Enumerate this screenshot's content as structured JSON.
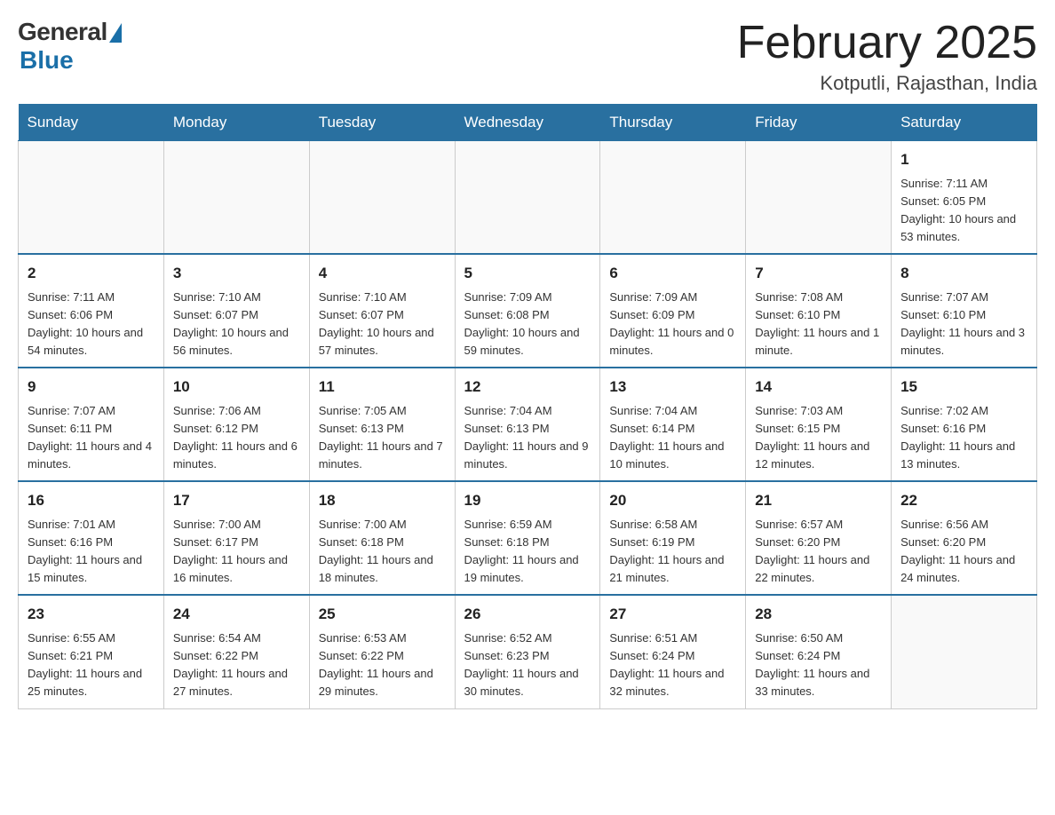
{
  "logo": {
    "general": "General",
    "blue": "Blue"
  },
  "header": {
    "title": "February 2025",
    "location": "Kotputli, Rajasthan, India"
  },
  "days_of_week": [
    "Sunday",
    "Monday",
    "Tuesday",
    "Wednesday",
    "Thursday",
    "Friday",
    "Saturday"
  ],
  "weeks": [
    [
      {
        "day": "",
        "info": ""
      },
      {
        "day": "",
        "info": ""
      },
      {
        "day": "",
        "info": ""
      },
      {
        "day": "",
        "info": ""
      },
      {
        "day": "",
        "info": ""
      },
      {
        "day": "",
        "info": ""
      },
      {
        "day": "1",
        "info": "Sunrise: 7:11 AM\nSunset: 6:05 PM\nDaylight: 10 hours and 53 minutes."
      }
    ],
    [
      {
        "day": "2",
        "info": "Sunrise: 7:11 AM\nSunset: 6:06 PM\nDaylight: 10 hours and 54 minutes."
      },
      {
        "day": "3",
        "info": "Sunrise: 7:10 AM\nSunset: 6:07 PM\nDaylight: 10 hours and 56 minutes."
      },
      {
        "day": "4",
        "info": "Sunrise: 7:10 AM\nSunset: 6:07 PM\nDaylight: 10 hours and 57 minutes."
      },
      {
        "day": "5",
        "info": "Sunrise: 7:09 AM\nSunset: 6:08 PM\nDaylight: 10 hours and 59 minutes."
      },
      {
        "day": "6",
        "info": "Sunrise: 7:09 AM\nSunset: 6:09 PM\nDaylight: 11 hours and 0 minutes."
      },
      {
        "day": "7",
        "info": "Sunrise: 7:08 AM\nSunset: 6:10 PM\nDaylight: 11 hours and 1 minute."
      },
      {
        "day": "8",
        "info": "Sunrise: 7:07 AM\nSunset: 6:10 PM\nDaylight: 11 hours and 3 minutes."
      }
    ],
    [
      {
        "day": "9",
        "info": "Sunrise: 7:07 AM\nSunset: 6:11 PM\nDaylight: 11 hours and 4 minutes."
      },
      {
        "day": "10",
        "info": "Sunrise: 7:06 AM\nSunset: 6:12 PM\nDaylight: 11 hours and 6 minutes."
      },
      {
        "day": "11",
        "info": "Sunrise: 7:05 AM\nSunset: 6:13 PM\nDaylight: 11 hours and 7 minutes."
      },
      {
        "day": "12",
        "info": "Sunrise: 7:04 AM\nSunset: 6:13 PM\nDaylight: 11 hours and 9 minutes."
      },
      {
        "day": "13",
        "info": "Sunrise: 7:04 AM\nSunset: 6:14 PM\nDaylight: 11 hours and 10 minutes."
      },
      {
        "day": "14",
        "info": "Sunrise: 7:03 AM\nSunset: 6:15 PM\nDaylight: 11 hours and 12 minutes."
      },
      {
        "day": "15",
        "info": "Sunrise: 7:02 AM\nSunset: 6:16 PM\nDaylight: 11 hours and 13 minutes."
      }
    ],
    [
      {
        "day": "16",
        "info": "Sunrise: 7:01 AM\nSunset: 6:16 PM\nDaylight: 11 hours and 15 minutes."
      },
      {
        "day": "17",
        "info": "Sunrise: 7:00 AM\nSunset: 6:17 PM\nDaylight: 11 hours and 16 minutes."
      },
      {
        "day": "18",
        "info": "Sunrise: 7:00 AM\nSunset: 6:18 PM\nDaylight: 11 hours and 18 minutes."
      },
      {
        "day": "19",
        "info": "Sunrise: 6:59 AM\nSunset: 6:18 PM\nDaylight: 11 hours and 19 minutes."
      },
      {
        "day": "20",
        "info": "Sunrise: 6:58 AM\nSunset: 6:19 PM\nDaylight: 11 hours and 21 minutes."
      },
      {
        "day": "21",
        "info": "Sunrise: 6:57 AM\nSunset: 6:20 PM\nDaylight: 11 hours and 22 minutes."
      },
      {
        "day": "22",
        "info": "Sunrise: 6:56 AM\nSunset: 6:20 PM\nDaylight: 11 hours and 24 minutes."
      }
    ],
    [
      {
        "day": "23",
        "info": "Sunrise: 6:55 AM\nSunset: 6:21 PM\nDaylight: 11 hours and 25 minutes."
      },
      {
        "day": "24",
        "info": "Sunrise: 6:54 AM\nSunset: 6:22 PM\nDaylight: 11 hours and 27 minutes."
      },
      {
        "day": "25",
        "info": "Sunrise: 6:53 AM\nSunset: 6:22 PM\nDaylight: 11 hours and 29 minutes."
      },
      {
        "day": "26",
        "info": "Sunrise: 6:52 AM\nSunset: 6:23 PM\nDaylight: 11 hours and 30 minutes."
      },
      {
        "day": "27",
        "info": "Sunrise: 6:51 AM\nSunset: 6:24 PM\nDaylight: 11 hours and 32 minutes."
      },
      {
        "day": "28",
        "info": "Sunrise: 6:50 AM\nSunset: 6:24 PM\nDaylight: 11 hours and 33 minutes."
      },
      {
        "day": "",
        "info": ""
      }
    ]
  ]
}
